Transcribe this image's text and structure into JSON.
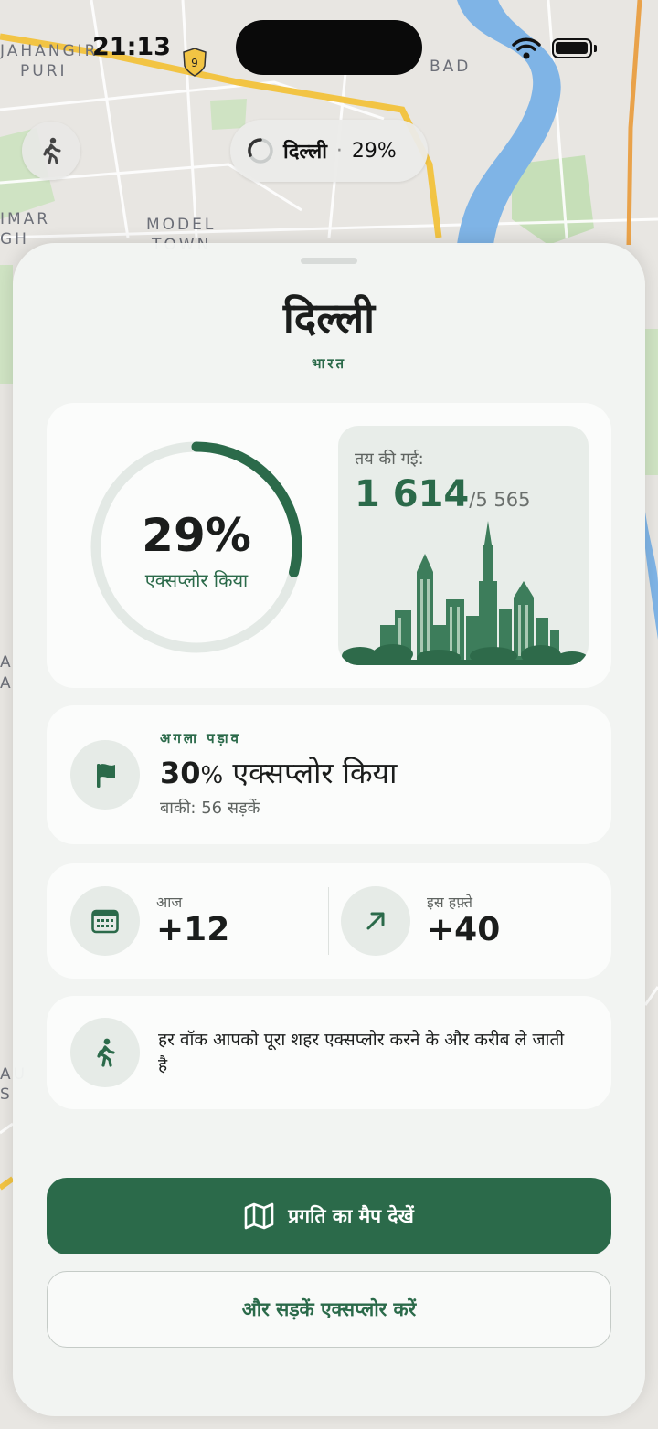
{
  "status_bar": {
    "time": "21:13"
  },
  "map": {
    "labels": [
      "JAHANGIR",
      "PURI",
      "BAD",
      "MODEL",
      "TOWN",
      "IMAR",
      "GH",
      "A",
      "A",
      "AU",
      "S"
    ],
    "shield_number": "9"
  },
  "top_pill": {
    "city": "दिल्ली",
    "separator": "·",
    "percent": "29%"
  },
  "sheet": {
    "title": "दिल्ली",
    "subtitle": "भारत",
    "progress": {
      "percent_text": "29%",
      "percent_value": 29,
      "label": "एक्सप्लोर किया"
    },
    "streets": {
      "label": "तय की गई:",
      "value": "1 614",
      "total": "/5 565"
    },
    "next_stop": {
      "overline": "अगला पड़ाव",
      "percent": "30",
      "percent_sign": "%",
      "title_rest": " एक्सप्लोर किया",
      "subtitle": "बाकी: 56 सड़कें"
    },
    "stats": {
      "today_label": "आज",
      "today_value": "+12",
      "week_label": "इस हफ़्ते",
      "week_value": "+40"
    },
    "tip": {
      "text": "हर वॉक आपको पूरा शहर एक्सप्लोर करने के और करीब ले जाती है"
    },
    "buttons": {
      "primary": "प्रगति का मैप देखें",
      "secondary": "और सड़कें एक्सप्लोर करें"
    }
  },
  "colors": {
    "accent": "#2b6a4a",
    "ring_track": "#e3e9e5",
    "river": "#7fb4e6",
    "road": "#f2c444"
  },
  "icons": [
    "shield-icon",
    "wifi-icon",
    "battery-icon",
    "walk-icon",
    "loading-ring-icon",
    "flag-icon",
    "calendar-icon",
    "arrow-up-right-icon",
    "map-icon"
  ]
}
